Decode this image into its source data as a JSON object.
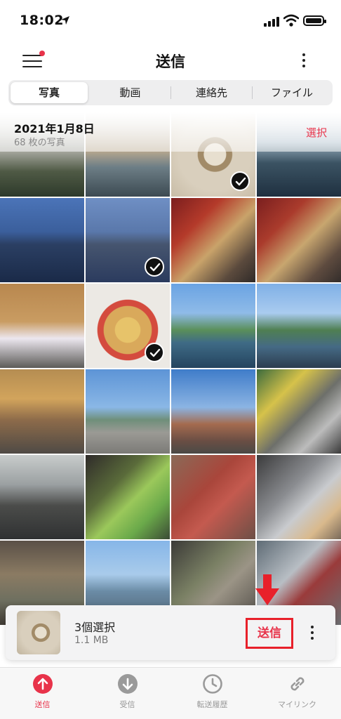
{
  "status_bar": {
    "time": "18:02"
  },
  "nav": {
    "title": "送信"
  },
  "segments": [
    {
      "label": "写真",
      "active": true
    },
    {
      "label": "動画",
      "active": false
    },
    {
      "label": "連絡先",
      "active": false
    },
    {
      "label": "ファイル",
      "active": false
    }
  ],
  "grid": {
    "date_title": "2021年1月8日",
    "photo_count": "68 枚の写真",
    "select_label": "選択"
  },
  "selection": {
    "count_label": "3個選択",
    "size_label": "1.1 MB",
    "send_label": "送信"
  },
  "tabs": [
    {
      "label": "送信",
      "icon": "send-icon",
      "active": true
    },
    {
      "label": "受信",
      "icon": "receive-icon",
      "active": false
    },
    {
      "label": "転送履歴",
      "icon": "history-icon",
      "active": false
    },
    {
      "label": "マイリンク",
      "icon": "link-icon",
      "active": false
    }
  ],
  "colors": {
    "accent": "#e8334a",
    "highlight_box": "#e8202a"
  }
}
